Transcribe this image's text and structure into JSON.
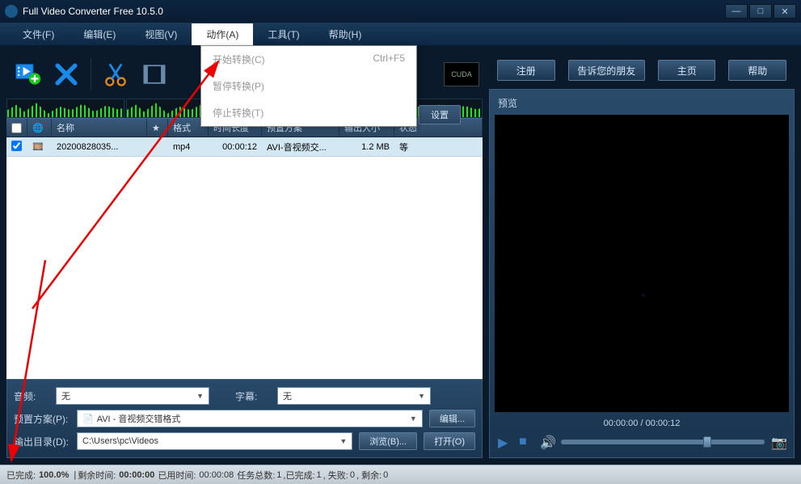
{
  "window": {
    "title": "Full Video Converter Free 10.5.0"
  },
  "menu": {
    "file": "文件(F)",
    "edit": "编辑(E)",
    "view": "视图(V)",
    "action": "动作(A)",
    "tools": "工具(T)",
    "help": "帮助(H)"
  },
  "dropdown": {
    "start": "开始转换(C)",
    "start_sc": "Ctrl+F5",
    "pause": "暂停转换(P)",
    "stop": "停止转换(T)"
  },
  "cuda": "CUDA",
  "hidden_btn": "设置",
  "columns": {
    "name": "名称",
    "star": "★",
    "fmt": "格式",
    "dur": "时间长度",
    "preset": "预置方案",
    "size": "输出大小",
    "status": "状态"
  },
  "row": {
    "checked": true,
    "name": "20200828035...",
    "fmt": "mp4",
    "dur": "00:00:12",
    "preset": "AVI-音视频交...",
    "size": "1.2 MB",
    "status": "等"
  },
  "audio": {
    "label": "音频:",
    "value": "无"
  },
  "subtitle": {
    "label": "字幕:",
    "value": "无"
  },
  "preset": {
    "label": "预置方案(P):",
    "value": "AVI - 音视频交错格式",
    "edit": "编辑..."
  },
  "outdir": {
    "label": "输出目录(D):",
    "value": "C:\\Users\\pc\\Videos",
    "browse": "浏览(B)...",
    "open": "打开(O)"
  },
  "rbtns": {
    "register": "注册",
    "tell": "告诉您的朋友",
    "home": "主页",
    "help": "帮助"
  },
  "preview": {
    "title": "预览",
    "time": "00:00:00 / 00:00:12"
  },
  "status": {
    "done_lbl": "已完成:",
    "done_pct": "100.0%",
    "remain_lbl": "剩余时间:",
    "remain": "00:00:00",
    "used_lbl": "已用时间:",
    "used": "00:00:08",
    "tasks_lbl": "任务总数:",
    "tasks": "1",
    "ok_lbl": ",已完成:",
    "ok": "1",
    "fail_lbl": ", 失败:",
    "fail": "0",
    "left_lbl": ", 剩余:",
    "left": "0"
  }
}
